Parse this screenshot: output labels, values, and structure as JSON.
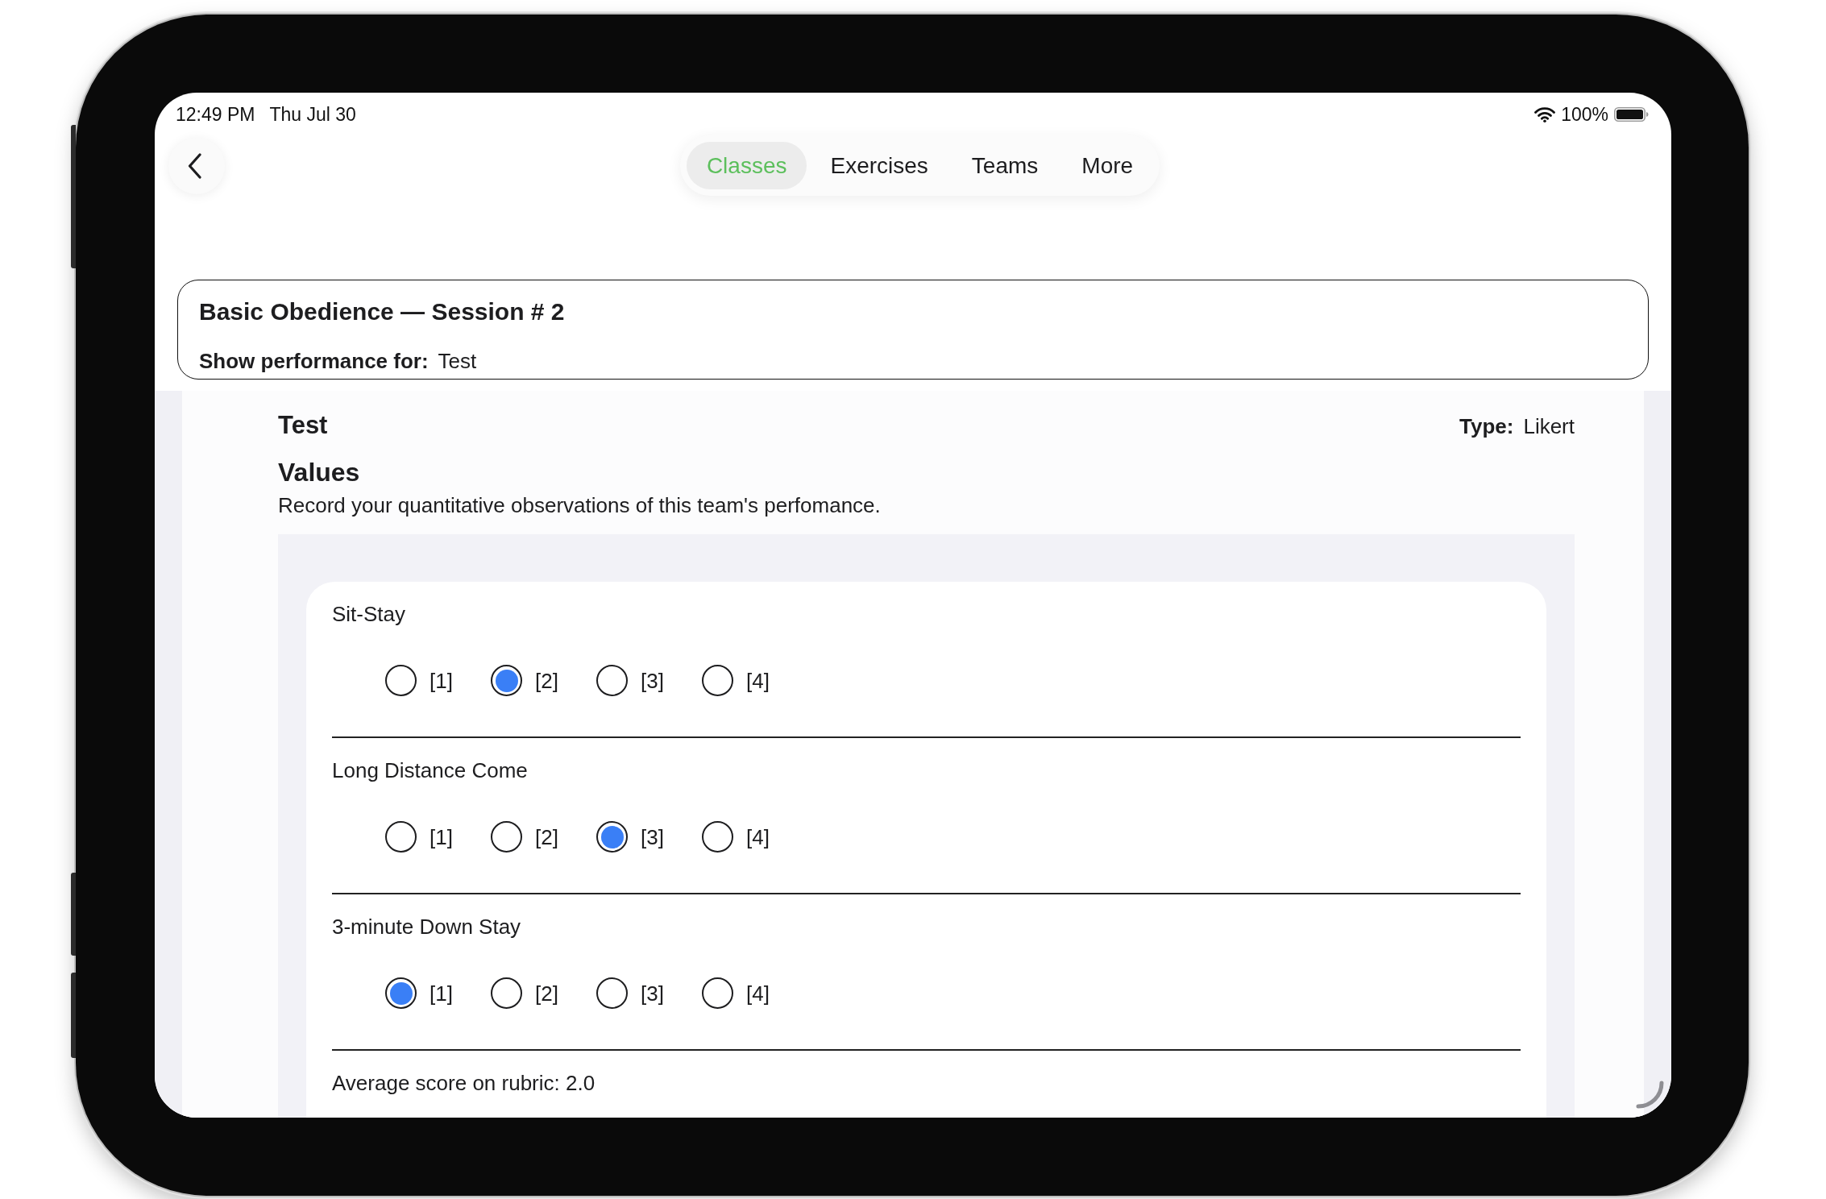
{
  "status_bar": {
    "time": "12:49 PM",
    "date": "Thu Jul 30",
    "battery": "100%"
  },
  "tabs": [
    {
      "label": "Classes",
      "selected": true
    },
    {
      "label": "Exercises",
      "selected": false
    },
    {
      "label": "Teams",
      "selected": false
    },
    {
      "label": "More",
      "selected": false
    }
  ],
  "header": {
    "title": "Basic Obedience — Session # 2",
    "filter_label": "Show performance for:",
    "filter_value": "Test"
  },
  "assessment": {
    "name": "Test",
    "type_label": "Type:",
    "type_value": "Likert",
    "section_title": "Values",
    "description": "Record your quantitative observations of this team's perfomance.",
    "criteria": [
      {
        "name": "Sit-Stay",
        "options": [
          {
            "label": "[1]",
            "selected": false
          },
          {
            "label": "[2]",
            "selected": true
          },
          {
            "label": "[3]",
            "selected": false
          },
          {
            "label": "[4]",
            "selected": false
          }
        ]
      },
      {
        "name": "Long Distance Come",
        "options": [
          {
            "label": "[1]",
            "selected": false
          },
          {
            "label": "[2]",
            "selected": false
          },
          {
            "label": "[3]",
            "selected": true
          },
          {
            "label": "[4]",
            "selected": false
          }
        ]
      },
      {
        "name": "3-minute Down Stay",
        "options": [
          {
            "label": "[1]",
            "selected": true
          },
          {
            "label": "[2]",
            "selected": false
          },
          {
            "label": "[3]",
            "selected": false
          },
          {
            "label": "[4]",
            "selected": false
          }
        ]
      }
    ],
    "average": "Average score on rubric: 2.0"
  }
}
